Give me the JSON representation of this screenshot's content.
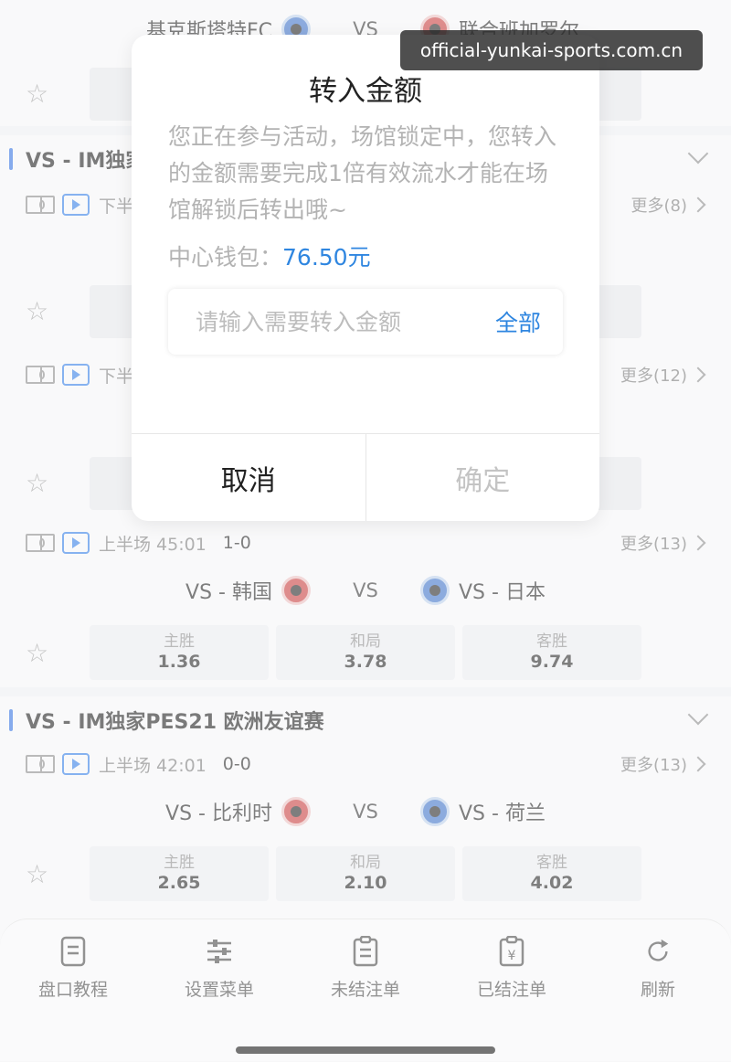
{
  "top_match": {
    "home": "基克斯塔特FC",
    "vs": "VS",
    "away": "联合班加罗尔"
  },
  "league1": {
    "name": "VS - IM独家"
  },
  "match_a": {
    "time": "下半",
    "more": "更多(8)"
  },
  "match_b": {
    "time": "下半",
    "more": "更多(12)"
  },
  "match_c": {
    "time": "上半场 45:01",
    "score": "1-0",
    "more": "更多(13)",
    "home": "VS - 韩国",
    "vs": "VS",
    "away": "VS - 日本",
    "odds": [
      {
        "label": "主胜",
        "value": "1.36"
      },
      {
        "label": "和局",
        "value": "3.78"
      },
      {
        "label": "客胜",
        "value": "9.74"
      }
    ]
  },
  "league2": {
    "name": "VS - IM独家PES21 欧洲友谊赛"
  },
  "match_d": {
    "time": "上半场 42:01",
    "score": "0-0",
    "more": "更多(13)",
    "home": "VS - 比利时",
    "vs": "VS",
    "away": "VS - 荷兰",
    "odds": [
      {
        "label": "主胜",
        "value": "2.65"
      },
      {
        "label": "和局",
        "value": "2.10"
      },
      {
        "label": "客胜",
        "value": "4.02"
      }
    ]
  },
  "star_glyph": "☆",
  "bottom_nav": [
    {
      "label": "盘口教程",
      "icon": "document-icon"
    },
    {
      "label": "设置菜单",
      "icon": "sliders-icon"
    },
    {
      "label": "未结注单",
      "icon": "clipboard-icon"
    },
    {
      "label": "已结注单",
      "icon": "yen-clipboard-icon"
    },
    {
      "label": "刷新",
      "icon": "refresh-icon"
    }
  ],
  "dialog": {
    "title": "转入金额",
    "message": "您正在参与活动，场馆锁定中，您转入的金额需要完成1倍有效流水才能在场馆解锁后转出哦~",
    "wallet_label": "中心钱包：",
    "wallet_amount": "76.50元",
    "input_placeholder": "请输入需要转入金额",
    "all_label": "全部",
    "cancel_label": "取消",
    "confirm_label": "确定"
  },
  "watermark": "official-yunkai-sports.com.cn",
  "colors": {
    "accent": "#2f86e0",
    "league_bar": "#2f6fe0"
  }
}
